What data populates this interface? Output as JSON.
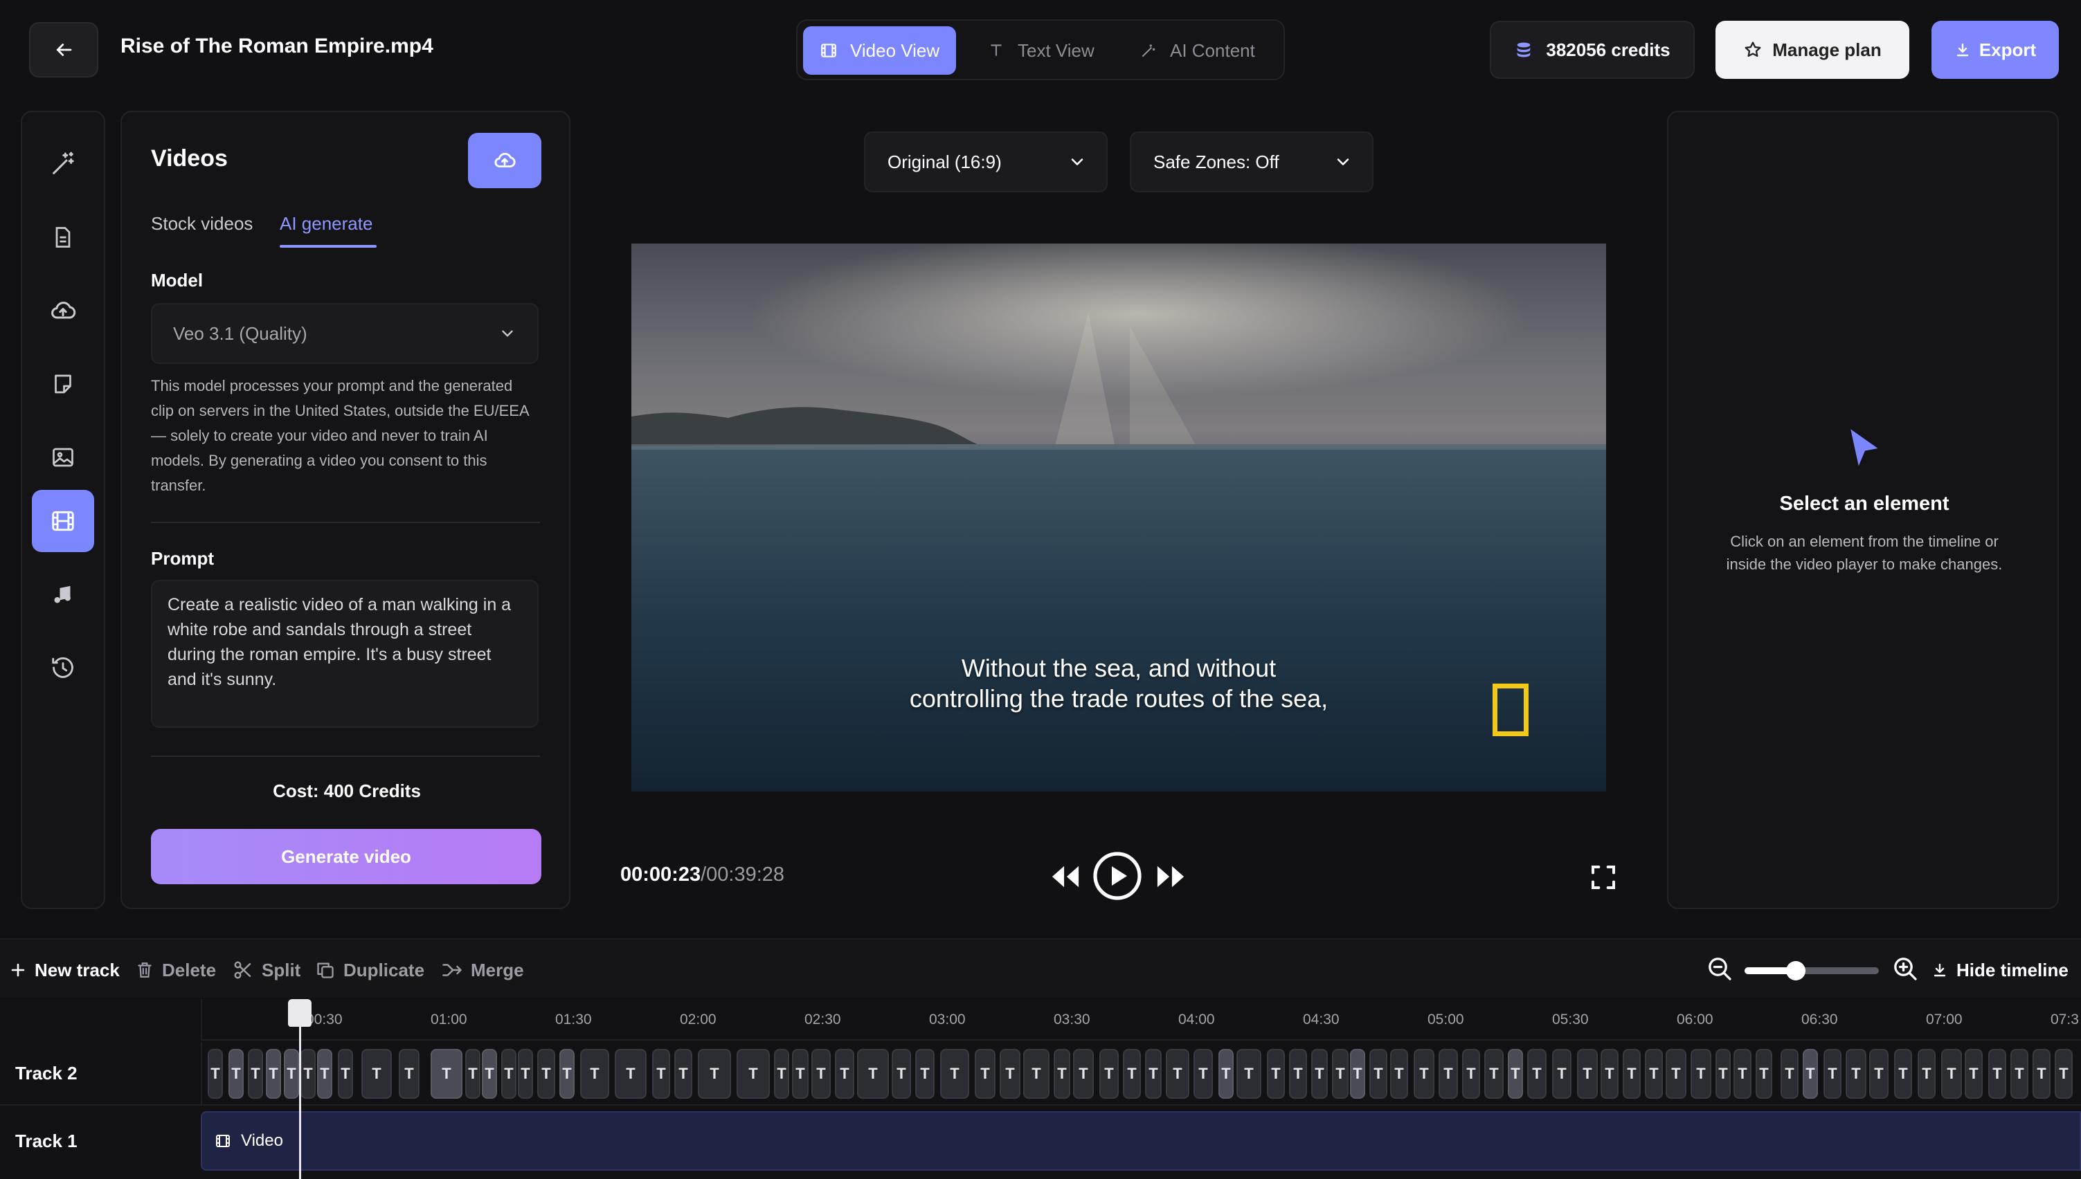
{
  "header": {
    "file_title": "Rise of The Roman Empire.mp4",
    "views": [
      {
        "label": "Video View",
        "icon": "film-icon",
        "active": true
      },
      {
        "label": "Text View",
        "icon": "text-icon",
        "active": false
      },
      {
        "label": "AI Content",
        "icon": "magic-wand-icon",
        "active": false
      }
    ],
    "credits": "382056 credits",
    "manage_plan": "Manage plan",
    "export": "Export"
  },
  "rail": [
    "magic-wand-icon",
    "document-icon",
    "cloud-upload-icon",
    "sticky-note-icon",
    "image-icon",
    "film-icon",
    "music-note-icon",
    "history-icon"
  ],
  "videos_panel": {
    "title": "Videos",
    "tabs": {
      "stock": "Stock videos",
      "ai": "AI generate"
    },
    "model_label": "Model",
    "model_value": "Veo 3.1 (Quality)",
    "model_note": "This model processes your prompt and the generated clip on servers in the United States, outside the EU/EEA — solely to create your video and never to train AI models. By generating a video you consent to this transfer.",
    "prompt_label": "Prompt",
    "prompt_text": "Create a realistic video of a man walking in a white robe and sandals through a street during the roman empire. It's a busy street and it's sunny.",
    "cost": "Cost: 400 Credits",
    "generate_label": "Generate video"
  },
  "player": {
    "aspect_dropdown": "Original (16:9)",
    "safe_zones_dropdown": "Safe Zones: Off",
    "subtitle_line1": "Without the sea, and without",
    "subtitle_line2": "controlling the trade routes of the sea,",
    "time_current": "00:00:23",
    "time_separator": "/",
    "time_total": "00:39:28"
  },
  "inspector": {
    "title": "Select an element",
    "description": "Click on an element from the timeline or inside the video player to make changes."
  },
  "timeline_toolbar": {
    "new_track": "New track",
    "delete": "Delete",
    "split": "Split",
    "duplicate": "Duplicate",
    "merge": "Merge",
    "hide_timeline": "Hide timeline",
    "zoom_level": 0.38
  },
  "timeline": {
    "ticks": [
      "00:30",
      "01:00",
      "01:30",
      "02:00",
      "02:30",
      "03:00",
      "03:30",
      "04:00",
      "04:30",
      "05:00",
      "05:30",
      "06:00",
      "06:30",
      "07:00",
      "07:3"
    ],
    "tracks": [
      {
        "label": "Track 2"
      },
      {
        "label": "Track 1",
        "clip_label": "Video"
      }
    ],
    "text_clip_glyph": "T"
  }
}
